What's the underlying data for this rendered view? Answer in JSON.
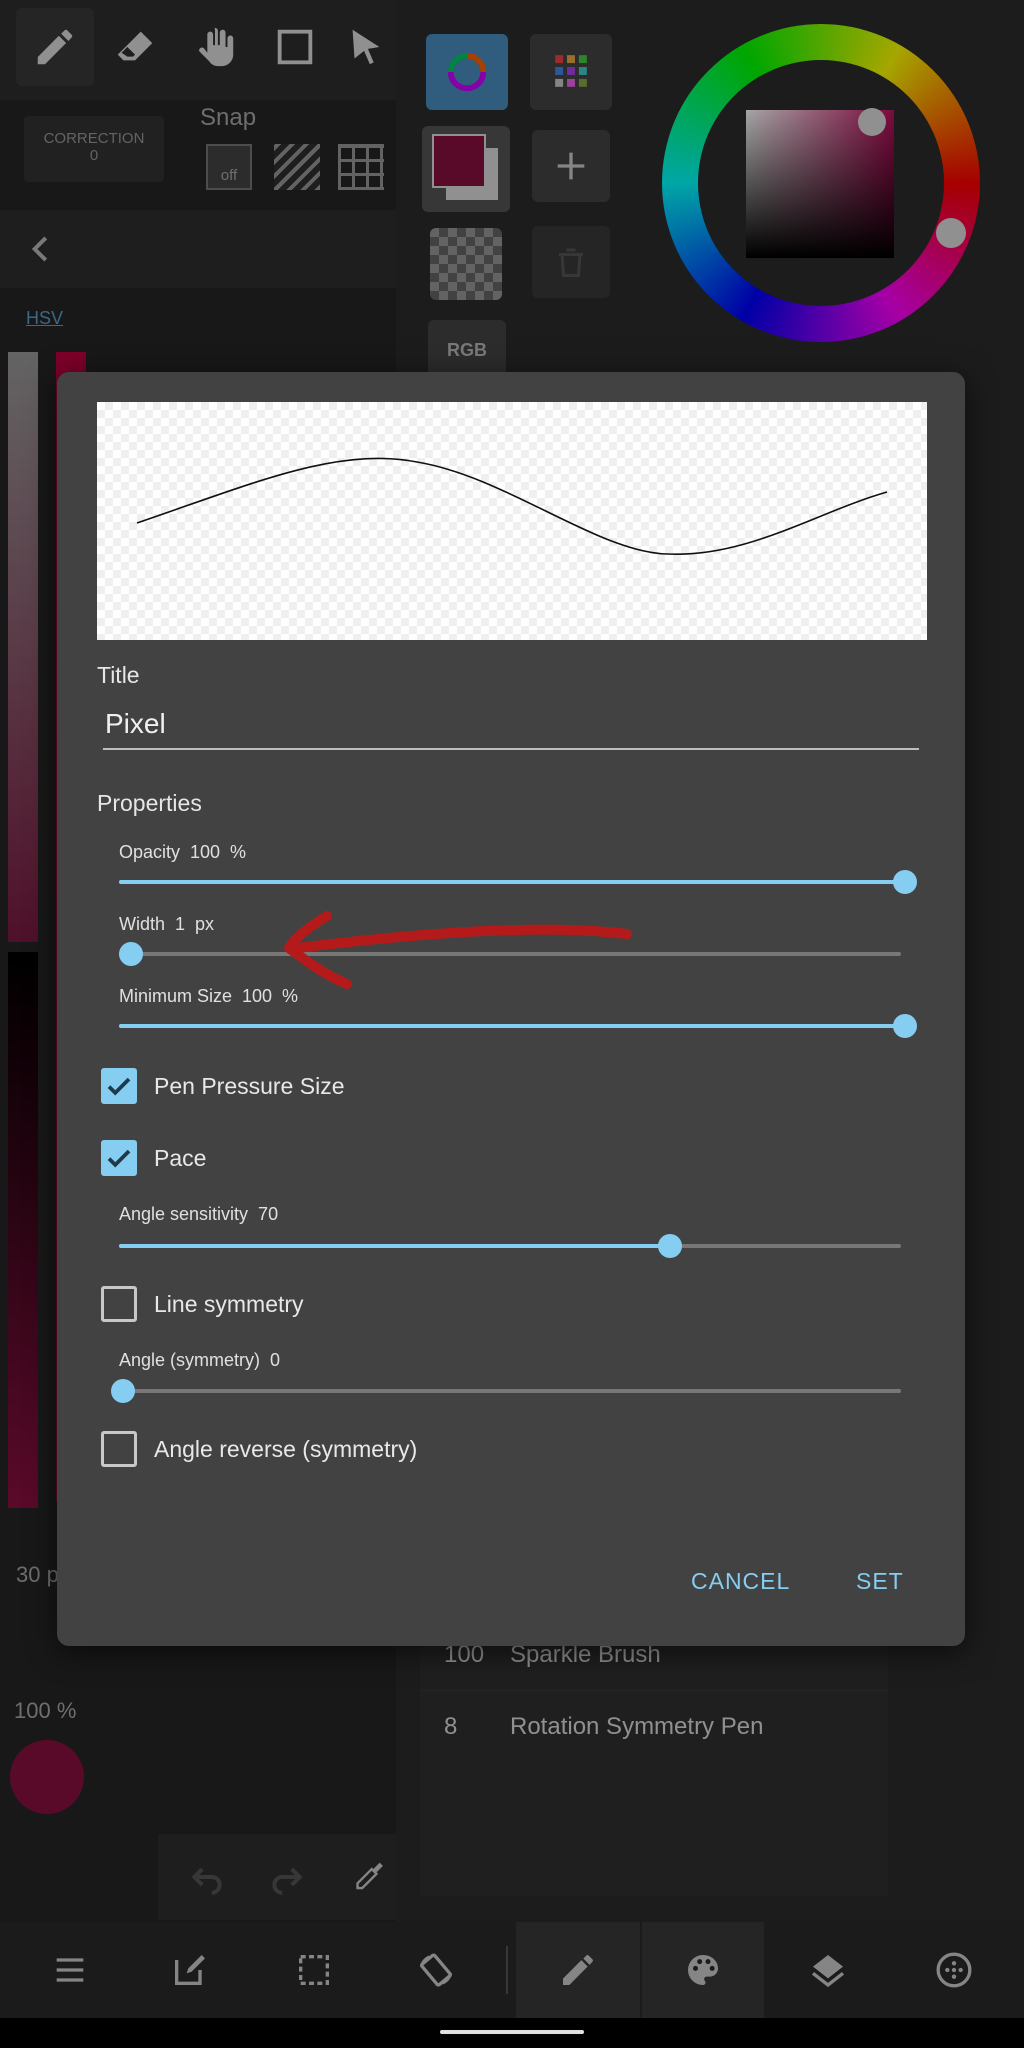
{
  "background_app": {
    "correction_label": "CORRECTION",
    "correction_value": "0",
    "snap_label": "Snap",
    "snap_off": "off",
    "color_mode_tab": "HSV",
    "rgb_button": "RGB",
    "size_readout": "30 p",
    "opacity_readout": "100 %",
    "brush_list": [
      {
        "number": "100",
        "name": "Sparkle Brush"
      },
      {
        "number": "8",
        "name": "Rotation Symmetry Pen"
      }
    ],
    "colors": {
      "primary": "#8b1040",
      "accent": "#86cdf2"
    }
  },
  "dialog": {
    "title_label": "Title",
    "title_value": "Pixel",
    "properties_label": "Properties",
    "sliders": {
      "opacity": {
        "label": "Opacity  100  %",
        "value": 100,
        "max": 100
      },
      "width": {
        "label": "Width  1  px",
        "value": 1,
        "max": 100
      },
      "minimum_size": {
        "label": "Minimum Size  100  %",
        "value": 100,
        "max": 100
      },
      "angle_sensitivity": {
        "label": "Angle sensitivity  70",
        "value": 70,
        "max": 100
      },
      "angle_symmetry": {
        "label": "Angle (symmetry)  0",
        "value": 0,
        "max": 100
      }
    },
    "checkboxes": {
      "pen_pressure_size": {
        "label": "Pen Pressure Size",
        "checked": true
      },
      "pace": {
        "label": "Pace",
        "checked": true
      },
      "line_symmetry": {
        "label": "Line symmetry",
        "checked": false
      },
      "angle_reverse": {
        "label": "Angle reverse (symmetry)",
        "checked": false
      }
    },
    "cancel_label": "CANCEL",
    "set_label": "SET"
  },
  "icons": {
    "top_toolbar": [
      "pen-icon",
      "eraser-icon",
      "hand-icon",
      "rectangle-icon",
      "select-arrow-icon"
    ],
    "bottom_bar": [
      "menu-icon",
      "edit-icon",
      "selection-icon",
      "rotate-canvas-icon",
      "brush-icon",
      "palette-icon",
      "layers-icon",
      "more-icon"
    ]
  }
}
